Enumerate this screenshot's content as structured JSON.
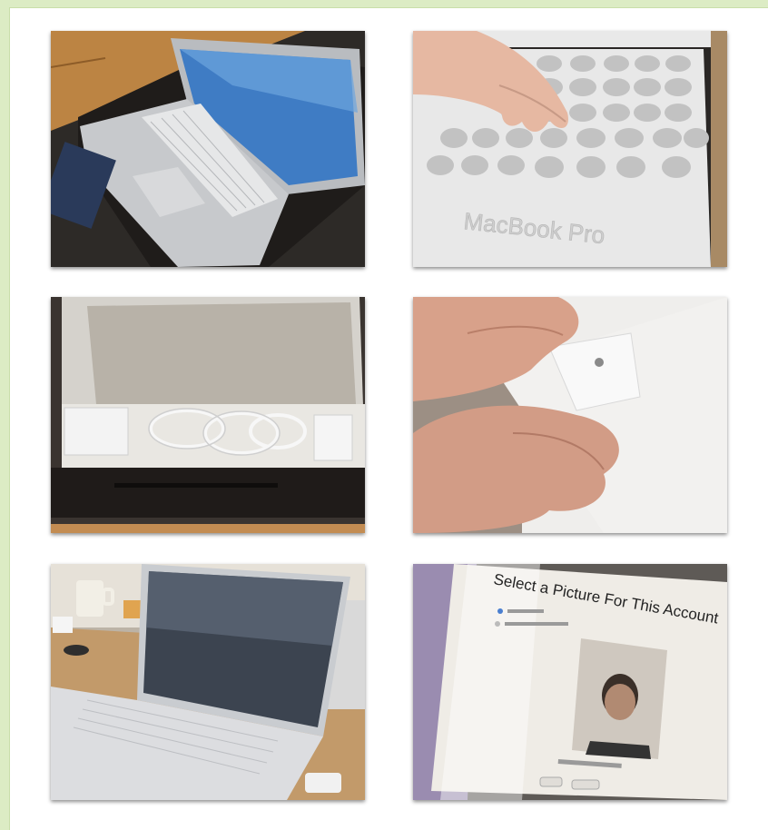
{
  "photos": [
    {
      "id": "macbook-on-box"
    },
    {
      "id": "macbook-pro-packaging-foam",
      "embossed_text": "MacBook Pro"
    },
    {
      "id": "box-accessories"
    },
    {
      "id": "hands-peeling-film"
    },
    {
      "id": "laptop-on-desk"
    },
    {
      "id": "setup-screen",
      "screen_title": "Select a Picture For This Account"
    }
  ]
}
